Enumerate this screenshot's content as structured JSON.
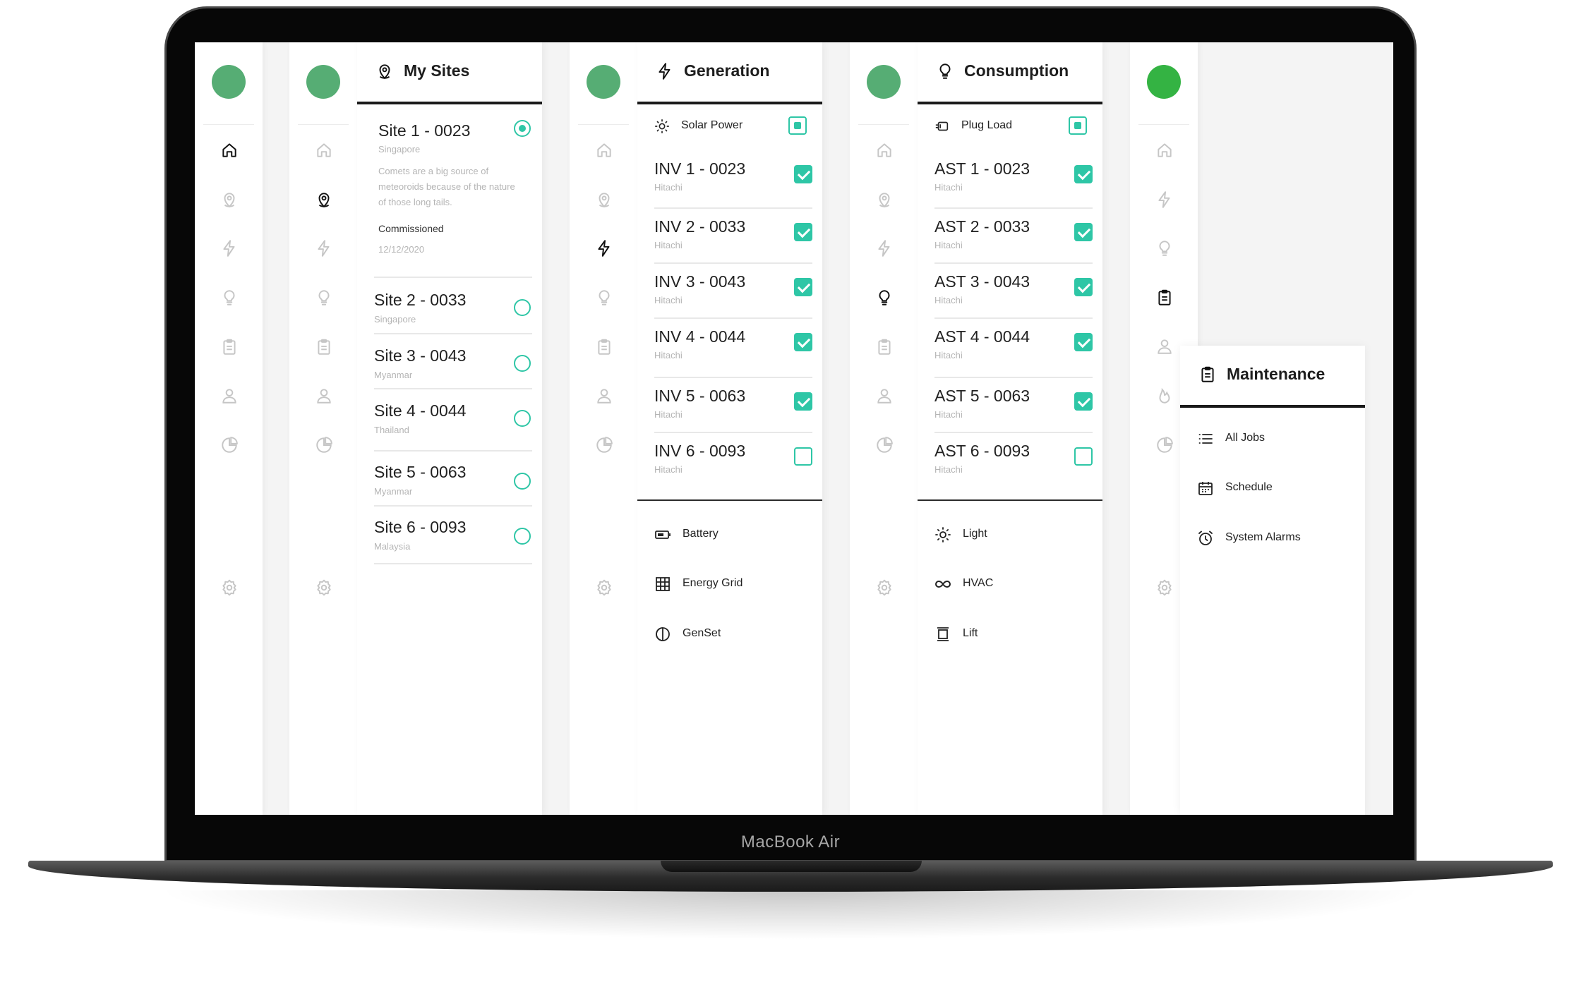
{
  "device": {
    "label": "MacBook Air"
  },
  "colors": {
    "accent": "#2ec6a6",
    "avatar": "#56ad74",
    "avatar_active": "#34b343"
  },
  "rail_icons": [
    "home-icon",
    "map-pin-icon",
    "lightning-icon",
    "bulb-icon",
    "clipboard-icon",
    "user-icon",
    "pie-chart-icon",
    "settings-icon"
  ],
  "sites_panel": {
    "title": "My Sites",
    "items": [
      {
        "name": "Site 1 - 0023",
        "location": "Singapore",
        "selected": true,
        "description": "Comets are a big source of meteoroids because of the nature of those long tails.",
        "commissioned_label": "Commissioned",
        "commissioned_date": "12/12/2020"
      },
      {
        "name": "Site 2 - 0033",
        "location": "Singapore",
        "selected": false
      },
      {
        "name": "Site 3 - 0043",
        "location": "Myanmar",
        "selected": false
      },
      {
        "name": "Site 4 - 0044",
        "location": "Thailand",
        "selected": false
      },
      {
        "name": "Site 5 - 0063",
        "location": "Myanmar",
        "selected": false
      },
      {
        "name": "Site 6 - 0093",
        "location": "Malaysia",
        "selected": false
      }
    ]
  },
  "generation_panel": {
    "title": "Generation",
    "group": {
      "label": "Solar Power",
      "icon": "sun-icon"
    },
    "devices": [
      {
        "name": "INV 1 - 0023",
        "maker": "Hitachi",
        "checked": true
      },
      {
        "name": "INV 2 - 0033",
        "maker": "Hitachi",
        "checked": true
      },
      {
        "name": "INV 3 - 0043",
        "maker": "Hitachi",
        "checked": true
      },
      {
        "name": "INV 4 - 0044",
        "maker": "Hitachi",
        "checked": true
      },
      {
        "name": "INV 5 - 0063",
        "maker": "Hitachi",
        "checked": true
      },
      {
        "name": "INV 6 - 0093",
        "maker": "Hitachi",
        "checked": false
      }
    ],
    "sections": [
      {
        "label": "Battery",
        "icon": "battery-icon"
      },
      {
        "label": "Energy Grid",
        "icon": "grid-icon"
      },
      {
        "label": "GenSet",
        "icon": "genset-icon"
      }
    ]
  },
  "consumption_panel": {
    "title": "Consumption",
    "group": {
      "label": "Plug Load",
      "icon": "plug-icon"
    },
    "devices": [
      {
        "name": "AST 1 - 0023",
        "maker": "Hitachi",
        "checked": true
      },
      {
        "name": "AST 2 - 0033",
        "maker": "Hitachi",
        "checked": true
      },
      {
        "name": "AST 3 - 0043",
        "maker": "Hitachi",
        "checked": true
      },
      {
        "name": "AST 4 - 0044",
        "maker": "Hitachi",
        "checked": true
      },
      {
        "name": "AST 5 - 0063",
        "maker": "Hitachi",
        "checked": true
      },
      {
        "name": "AST 6 - 0093",
        "maker": "Hitachi",
        "checked": false
      }
    ],
    "sections": [
      {
        "label": "Light",
        "icon": "light-icon"
      },
      {
        "label": "HVAC",
        "icon": "hvac-icon"
      },
      {
        "label": "Lift",
        "icon": "lift-icon"
      }
    ]
  },
  "maintenance_panel": {
    "title": "Maintenance",
    "items": [
      {
        "label": "All Jobs",
        "icon": "list-icon"
      },
      {
        "label": "Schedule",
        "icon": "calendar-icon"
      },
      {
        "label": "System Alarms",
        "icon": "alarm-clock-icon"
      }
    ]
  }
}
